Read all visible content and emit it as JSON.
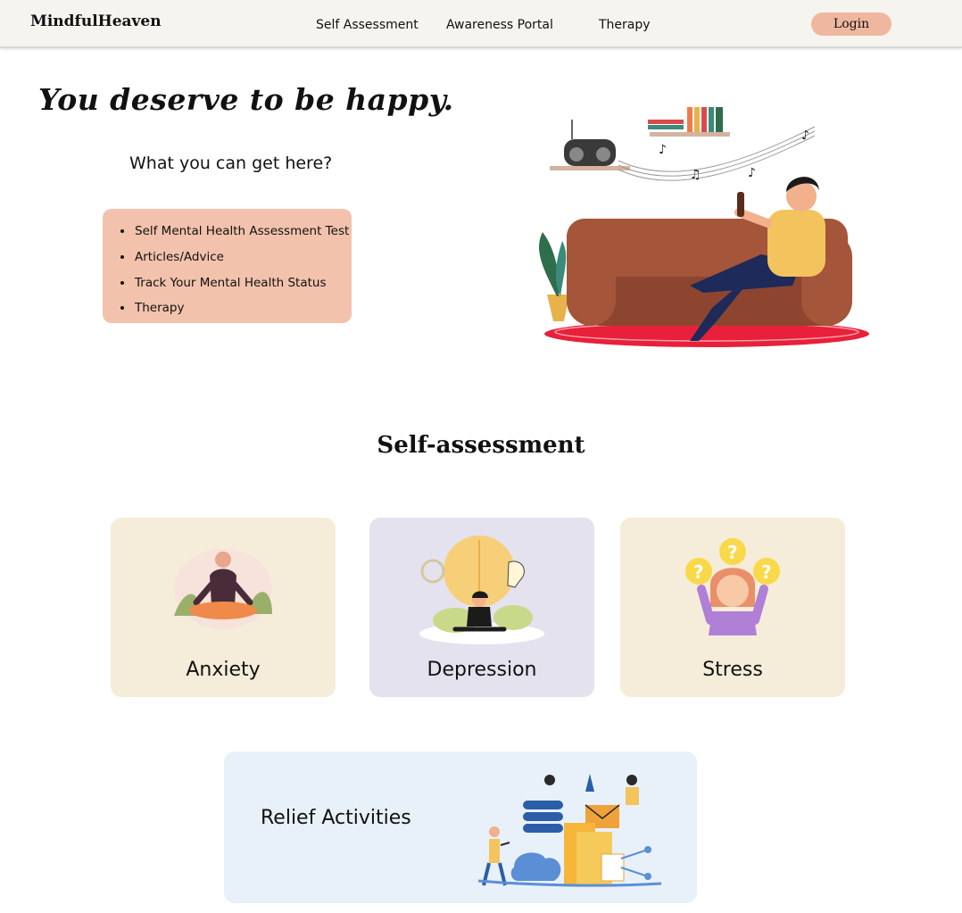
{
  "nav": {
    "brand": "MindfulHeaven",
    "links": [
      "Self Assessment",
      "Awareness Portal",
      "Therapy"
    ],
    "login_label": "Login"
  },
  "hero": {
    "title": "You deserve to be happy.",
    "subtitle": "What you can get here?",
    "features": [
      "Self Mental Health Assessment Test",
      "Articles/Advice",
      "Track Your Mental Health Status",
      "Therapy"
    ]
  },
  "assessment": {
    "title": "Self-assessment",
    "cards": [
      {
        "label": "Anxiety",
        "bg": "#f5edd9"
      },
      {
        "label": "Depression",
        "bg": "#e4e2ef"
      },
      {
        "label": "Stress",
        "bg": "#f5edd9"
      }
    ]
  },
  "relief": {
    "label": "Relief Activities",
    "bg": "#e8f1f9"
  },
  "colors": {
    "accent": "#f0b7a0",
    "features_bg": "#f2c2ac",
    "nav_bg": "#f5f4ef"
  }
}
